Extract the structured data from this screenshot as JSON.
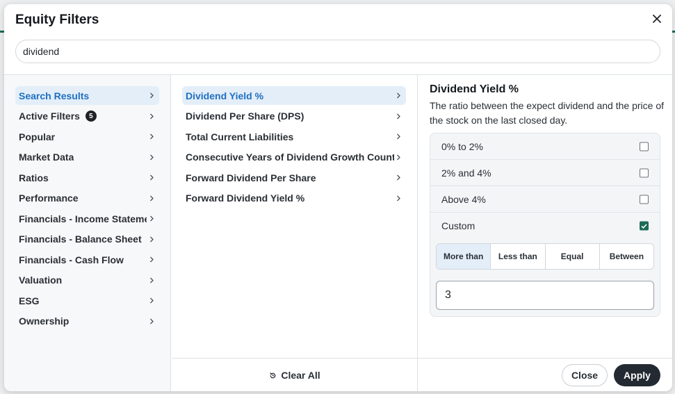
{
  "modal": {
    "title": "Equity Filters",
    "search_value": "dividend",
    "search_placeholder": ""
  },
  "categories": [
    {
      "label": "Search Results",
      "active": true
    },
    {
      "label": "Active Filters",
      "badge": "5"
    },
    {
      "label": "Popular"
    },
    {
      "label": "Market Data"
    },
    {
      "label": "Ratios"
    },
    {
      "label": "Performance"
    },
    {
      "label": "Financials - Income Statement"
    },
    {
      "label": "Financials - Balance Sheet"
    },
    {
      "label": "Financials - Cash Flow"
    },
    {
      "label": "Valuation"
    },
    {
      "label": "ESG"
    },
    {
      "label": "Ownership"
    }
  ],
  "results": [
    {
      "label": "Dividend Yield %",
      "active": true
    },
    {
      "label": "Dividend Per Share (DPS)"
    },
    {
      "label": "Total Current Liabilities"
    },
    {
      "label": "Consecutive Years of Dividend Growth Count"
    },
    {
      "label": "Forward Dividend Per Share"
    },
    {
      "label": "Forward Dividend Yield %"
    }
  ],
  "detail": {
    "title": "Dividend Yield %",
    "description": "The ratio between the expect dividend and the price of the stock on the last closed day.",
    "options": [
      {
        "label": "0% to 2%",
        "checked": false
      },
      {
        "label": "2% and 4%",
        "checked": false
      },
      {
        "label": "Above 4%",
        "checked": false
      },
      {
        "label": "Custom",
        "checked": true
      }
    ],
    "comparators": [
      "More than",
      "Less than",
      "Equal",
      "Between"
    ],
    "selected_comparator": "More than",
    "custom_value": "3"
  },
  "footer": {
    "clear_all": "Clear All",
    "close": "Close",
    "apply": "Apply"
  },
  "colors": {
    "accent": "#1b6b57",
    "active_bg": "#e3eef9",
    "active_text": "#1f6fbf",
    "apply_bg": "#232a31"
  }
}
